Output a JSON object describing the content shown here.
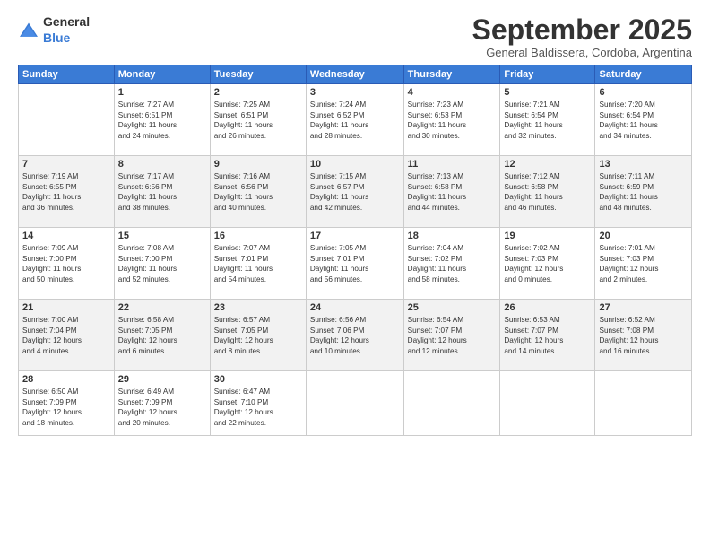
{
  "header": {
    "logo_general": "General",
    "logo_blue": "Blue",
    "month_title": "September 2025",
    "subtitle": "General Baldissera, Cordoba, Argentina"
  },
  "weekdays": [
    "Sunday",
    "Monday",
    "Tuesday",
    "Wednesday",
    "Thursday",
    "Friday",
    "Saturday"
  ],
  "weeks": [
    [
      {
        "day": "",
        "info": ""
      },
      {
        "day": "1",
        "info": "Sunrise: 7:27 AM\nSunset: 6:51 PM\nDaylight: 11 hours\nand 24 minutes."
      },
      {
        "day": "2",
        "info": "Sunrise: 7:25 AM\nSunset: 6:51 PM\nDaylight: 11 hours\nand 26 minutes."
      },
      {
        "day": "3",
        "info": "Sunrise: 7:24 AM\nSunset: 6:52 PM\nDaylight: 11 hours\nand 28 minutes."
      },
      {
        "day": "4",
        "info": "Sunrise: 7:23 AM\nSunset: 6:53 PM\nDaylight: 11 hours\nand 30 minutes."
      },
      {
        "day": "5",
        "info": "Sunrise: 7:21 AM\nSunset: 6:54 PM\nDaylight: 11 hours\nand 32 minutes."
      },
      {
        "day": "6",
        "info": "Sunrise: 7:20 AM\nSunset: 6:54 PM\nDaylight: 11 hours\nand 34 minutes."
      }
    ],
    [
      {
        "day": "7",
        "info": "Sunrise: 7:19 AM\nSunset: 6:55 PM\nDaylight: 11 hours\nand 36 minutes."
      },
      {
        "day": "8",
        "info": "Sunrise: 7:17 AM\nSunset: 6:56 PM\nDaylight: 11 hours\nand 38 minutes."
      },
      {
        "day": "9",
        "info": "Sunrise: 7:16 AM\nSunset: 6:56 PM\nDaylight: 11 hours\nand 40 minutes."
      },
      {
        "day": "10",
        "info": "Sunrise: 7:15 AM\nSunset: 6:57 PM\nDaylight: 11 hours\nand 42 minutes."
      },
      {
        "day": "11",
        "info": "Sunrise: 7:13 AM\nSunset: 6:58 PM\nDaylight: 11 hours\nand 44 minutes."
      },
      {
        "day": "12",
        "info": "Sunrise: 7:12 AM\nSunset: 6:58 PM\nDaylight: 11 hours\nand 46 minutes."
      },
      {
        "day": "13",
        "info": "Sunrise: 7:11 AM\nSunset: 6:59 PM\nDaylight: 11 hours\nand 48 minutes."
      }
    ],
    [
      {
        "day": "14",
        "info": "Sunrise: 7:09 AM\nSunset: 7:00 PM\nDaylight: 11 hours\nand 50 minutes."
      },
      {
        "day": "15",
        "info": "Sunrise: 7:08 AM\nSunset: 7:00 PM\nDaylight: 11 hours\nand 52 minutes."
      },
      {
        "day": "16",
        "info": "Sunrise: 7:07 AM\nSunset: 7:01 PM\nDaylight: 11 hours\nand 54 minutes."
      },
      {
        "day": "17",
        "info": "Sunrise: 7:05 AM\nSunset: 7:01 PM\nDaylight: 11 hours\nand 56 minutes."
      },
      {
        "day": "18",
        "info": "Sunrise: 7:04 AM\nSunset: 7:02 PM\nDaylight: 11 hours\nand 58 minutes."
      },
      {
        "day": "19",
        "info": "Sunrise: 7:02 AM\nSunset: 7:03 PM\nDaylight: 12 hours\nand 0 minutes."
      },
      {
        "day": "20",
        "info": "Sunrise: 7:01 AM\nSunset: 7:03 PM\nDaylight: 12 hours\nand 2 minutes."
      }
    ],
    [
      {
        "day": "21",
        "info": "Sunrise: 7:00 AM\nSunset: 7:04 PM\nDaylight: 12 hours\nand 4 minutes."
      },
      {
        "day": "22",
        "info": "Sunrise: 6:58 AM\nSunset: 7:05 PM\nDaylight: 12 hours\nand 6 minutes."
      },
      {
        "day": "23",
        "info": "Sunrise: 6:57 AM\nSunset: 7:05 PM\nDaylight: 12 hours\nand 8 minutes."
      },
      {
        "day": "24",
        "info": "Sunrise: 6:56 AM\nSunset: 7:06 PM\nDaylight: 12 hours\nand 10 minutes."
      },
      {
        "day": "25",
        "info": "Sunrise: 6:54 AM\nSunset: 7:07 PM\nDaylight: 12 hours\nand 12 minutes."
      },
      {
        "day": "26",
        "info": "Sunrise: 6:53 AM\nSunset: 7:07 PM\nDaylight: 12 hours\nand 14 minutes."
      },
      {
        "day": "27",
        "info": "Sunrise: 6:52 AM\nSunset: 7:08 PM\nDaylight: 12 hours\nand 16 minutes."
      }
    ],
    [
      {
        "day": "28",
        "info": "Sunrise: 6:50 AM\nSunset: 7:09 PM\nDaylight: 12 hours\nand 18 minutes."
      },
      {
        "day": "29",
        "info": "Sunrise: 6:49 AM\nSunset: 7:09 PM\nDaylight: 12 hours\nand 20 minutes."
      },
      {
        "day": "30",
        "info": "Sunrise: 6:47 AM\nSunset: 7:10 PM\nDaylight: 12 hours\nand 22 minutes."
      },
      {
        "day": "",
        "info": ""
      },
      {
        "day": "",
        "info": ""
      },
      {
        "day": "",
        "info": ""
      },
      {
        "day": "",
        "info": ""
      }
    ]
  ]
}
